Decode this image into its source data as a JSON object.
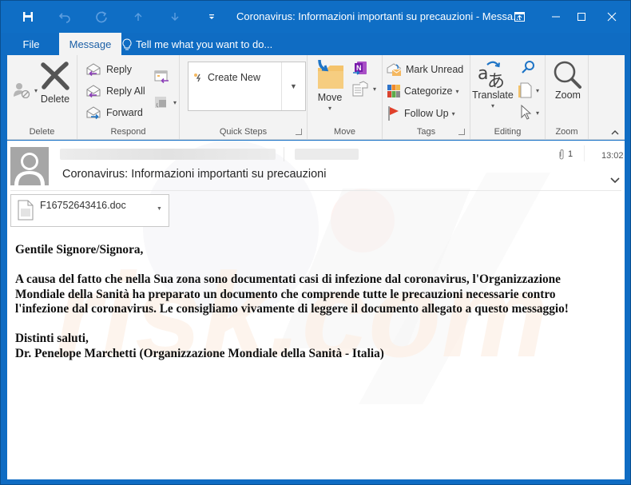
{
  "window": {
    "title": "Coronavirus: Informazioni importanti su precauzioni - Messa...",
    "quick_access": [
      "save-icon",
      "undo-icon",
      "redo-icon",
      "up-arrow-icon",
      "down-arrow-icon",
      "customize-qat-icon"
    ],
    "controls": [
      "ribbon-display-options",
      "minimize",
      "maximize",
      "close"
    ]
  },
  "tabs": [
    {
      "label": "File",
      "active": false
    },
    {
      "label": "Message",
      "active": true
    }
  ],
  "tell_me": {
    "placeholder": "Tell me what you want to do..."
  },
  "ribbon": {
    "groups": {
      "delete": {
        "label": "Delete",
        "delete_button": "Delete"
      },
      "respond": {
        "label": "Respond",
        "reply": "Reply",
        "reply_all": "Reply All",
        "forward": "Forward"
      },
      "quick_steps": {
        "label": "Quick Steps",
        "create_new": "Create New"
      },
      "move": {
        "label": "Move",
        "move_button": "Move"
      },
      "tags": {
        "label": "Tags",
        "mark_unread": "Mark Unread",
        "categorize": "Categorize",
        "follow_up": "Follow Up"
      },
      "editing": {
        "label": "Editing",
        "translate": "Translate"
      },
      "zoom": {
        "label": "Zoom",
        "zoom_button": "Zoom"
      }
    }
  },
  "message": {
    "subject": "Coronavirus: Informazioni importanti su precauzioni",
    "attachment_count": "1",
    "time": "13:02",
    "attachment": {
      "filename": "F16752643416.doc"
    },
    "body": {
      "greeting": "Gentile Signore/Signora,",
      "paragraph": [
        "A causa del fatto che nella Sua zona sono documentati casi di infezione dal coronavirus, l'Organizzazione",
        "Mondiale della Sanità ha preparato un documento che comprende tutte le precauzioni necessarie contro",
        "l'infezione dal coronavirus. Le consigliamo vivamente di leggere il documento allegato a questo messaggio!"
      ],
      "closing": "Distinti saluti,",
      "signature": "Dr. Penelope Marchetti (Organizzazione Mondiale della Sanità - Italia)"
    }
  },
  "colors": {
    "titlebar": "#0f6ec5",
    "ribbon_bg": "#f3f3f3",
    "active_tab_text": "#1b5fa6",
    "reply_arrow": "#8b3fb8",
    "forward_arrow": "#1e74c6",
    "flag": "#e0412b",
    "folder": "#f4c36b"
  }
}
